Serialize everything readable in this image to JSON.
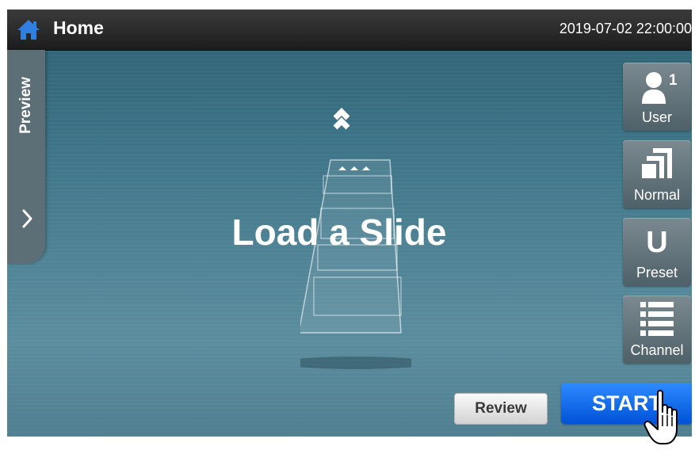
{
  "topbar": {
    "title": "Home",
    "datetime": "2019-07-02  22:00:00",
    "home_icon": "home-icon"
  },
  "preview_tab": {
    "label": "Preview",
    "chevron_icon": "chevron-right-icon"
  },
  "main": {
    "message": "Load a Slide"
  },
  "side_buttons": {
    "user": {
      "label": "User",
      "count": "1",
      "icon": "user-icon"
    },
    "view": {
      "label": "Normal",
      "icon": "normal-view-icon"
    },
    "preset": {
      "label": "Preset",
      "letter": "U"
    },
    "channel": {
      "label": "Channel",
      "icon": "channel-list-icon"
    }
  },
  "actions": {
    "review_label": "Review",
    "start_label": "START"
  },
  "colors": {
    "topbar": "#1c1c1c",
    "background": "#3c7386",
    "start_button": "#0a64f0",
    "home_icon": "#2f7fe0"
  }
}
